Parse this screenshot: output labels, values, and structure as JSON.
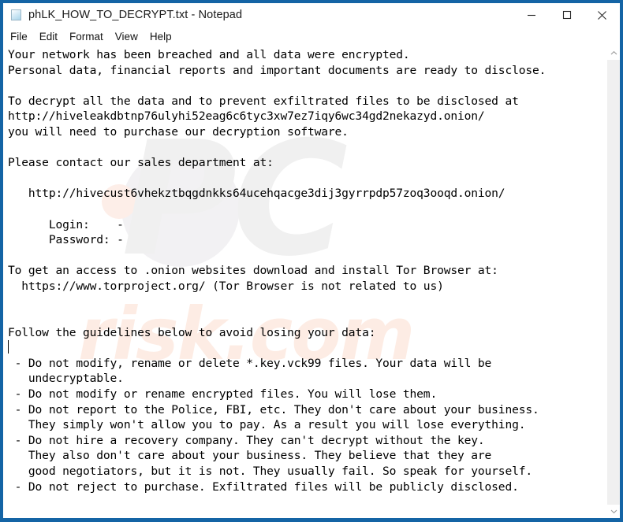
{
  "window": {
    "title": "phLK_HOW_TO_DECRYPT.txt - Notepad",
    "icon": "text-document-icon",
    "border_color": "#1464a5",
    "controls": {
      "minimize": "minimize-icon",
      "maximize": "maximize-icon",
      "close": "close-icon"
    }
  },
  "menu": {
    "items": [
      {
        "label": "File"
      },
      {
        "label": "Edit"
      },
      {
        "label": "Format"
      },
      {
        "label": "View"
      },
      {
        "label": "Help"
      }
    ]
  },
  "editor": {
    "content": "Your network has been breached and all data were encrypted.\nPersonal data, financial reports and important documents are ready to disclose.\n\nTo decrypt all the data and to prevent exfiltrated files to be disclosed at\nhttp://hiveleakdbtnp76ulyhi52eag6c6tyc3xw7ez7iqy6wc34gd2nekazyd.onion/\nyou will need to purchase our decryption software.\n\nPlease contact our sales department at:\n\n   http://hivecust6vhekztbqgdnkks64ucehqacge3dij3gyrrpdp57zoq3ooqd.onion/\n\n      Login:    -\n      Password: -\n\nTo get an access to .onion websites download and install Tor Browser at:\n  https://www.torproject.org/ (Tor Browser is not related to us)\n\n\nFollow the guidelines below to avoid losing your data:\n\n - Do not modify, rename or delete *.key.vck99 files. Your data will be\n   undecryptable.\n - Do not modify or rename encrypted files. You will lose them.\n - Do not report to the Police, FBI, etc. They don't care about your business.\n   They simply won't allow you to pay. As a result you will lose everything.\n - Do not hire a recovery company. They can't decrypt without the key.\n   They also don't care about your business. They believe that they are\n   good negotiators, but it is not. They usually fail. So speak for yourself.\n - Do not reject to purchase. Exfiltrated files will be publicly disclosed."
  },
  "watermark": {
    "primary": "PC",
    "secondary": "risk.com"
  },
  "scrollbar": {
    "up_arrow": "chevron-up-icon",
    "down_arrow": "chevron-down-icon"
  }
}
